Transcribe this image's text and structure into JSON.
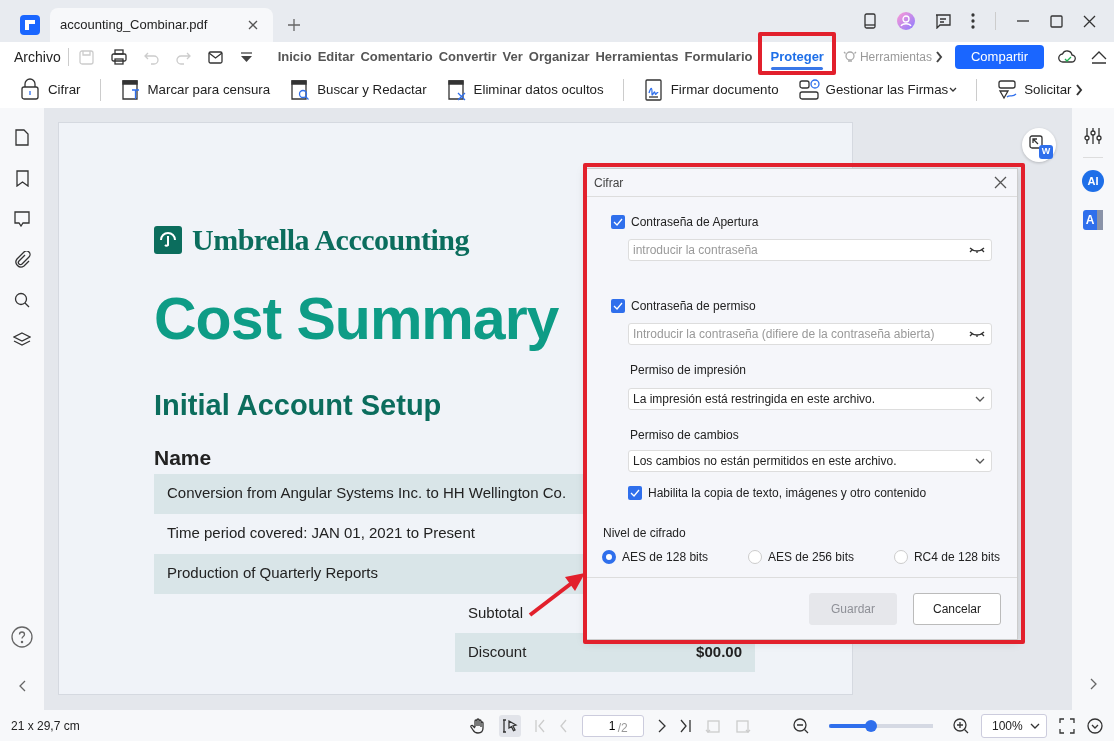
{
  "window": {
    "tabs": [
      {
        "title": "accounting_Combinar.pdf",
        "selected": true
      }
    ]
  },
  "menu": {
    "file": "Archivo",
    "items": [
      {
        "label": "Inicio",
        "selected": false
      },
      {
        "label": "Editar",
        "selected": false
      },
      {
        "label": "Comentario",
        "selected": false
      },
      {
        "label": "Convertir",
        "selected": false
      },
      {
        "label": "Ver",
        "selected": false
      },
      {
        "label": "Organizar",
        "selected": false
      },
      {
        "label": "Herramientas",
        "selected": false
      },
      {
        "label": "Formulario",
        "selected": false
      },
      {
        "label": "Proteger",
        "selected": true
      }
    ],
    "tools_hint": "Herramientas",
    "share": "Compartir"
  },
  "toolbar_groups": [
    {
      "items": [
        {
          "label": "Cifrar",
          "has_menu": false
        }
      ]
    },
    {
      "items": [
        {
          "label": "Marcar para censura",
          "has_menu": false
        },
        {
          "label": "Buscar y Redactar",
          "has_menu": false
        },
        {
          "label": "Eliminar datos ocultos",
          "has_menu": false
        }
      ]
    },
    {
      "items": [
        {
          "label": "Firmar documento",
          "has_menu": false
        },
        {
          "label": "Gestionar las Firmas",
          "has_menu": true
        }
      ]
    },
    {
      "items": [
        {
          "label": "Solicitar",
          "has_menu": false
        }
      ]
    }
  ],
  "document": {
    "brand": "Umbrella Acccounting",
    "title": "Cost Summary",
    "subtitle": "Initial Account Setup",
    "table_heading": "Name",
    "rows": [
      {
        "text": "Conversion from Angular Systems Inc. to HH Wellington Co.",
        "shaded": true
      },
      {
        "text": "Time period covered: JAN 01, 2021 to Present",
        "shaded": false
      },
      {
        "text": "Production of Quarterly Reports",
        "shaded": true
      }
    ],
    "totals": [
      {
        "label": "Subtotal",
        "shaded": false
      },
      {
        "label": "Discount",
        "value": "$00.00",
        "shaded": true
      }
    ]
  },
  "floating": {
    "word_badge": "W"
  },
  "right_sidebar": {
    "ai": "AI",
    "translate": "A"
  },
  "dialog": {
    "title": "Cifrar",
    "open_password": {
      "label": "Contraseña de Apertura",
      "checked": true,
      "placeholder": "introducir la contraseña"
    },
    "permission_password": {
      "label": "Contraseña de permiso",
      "checked": true,
      "placeholder": "Introducir la contraseña (difiere de la contraseña abierta)"
    },
    "print_permission": {
      "label": "Permiso de impresión",
      "value": "La impresión está restringida en este archivo."
    },
    "change_permission": {
      "label": "Permiso de cambios",
      "value": "Los cambios no están permitidos en este archivo."
    },
    "copy_enable": {
      "label": "Habilita la copia de texto, imágenes y otro contenido",
      "checked": true
    },
    "encryption": {
      "label": "Nivel de cifrado",
      "options": [
        {
          "label": "AES de 128 bits",
          "selected": true
        },
        {
          "label": "AES de 256 bits",
          "selected": false
        },
        {
          "label": "RC4 de 128 bits",
          "selected": false
        }
      ]
    },
    "save": {
      "label": "Guardar",
      "disabled": true
    },
    "cancel": {
      "label": "Cancelar",
      "disabled": false
    }
  },
  "status_bar": {
    "page_size": "21 x 29,7 cm",
    "page_input": "1",
    "page_total": "/2",
    "zoom_slider": {
      "level": 0.4
    },
    "zoom": "100%"
  }
}
